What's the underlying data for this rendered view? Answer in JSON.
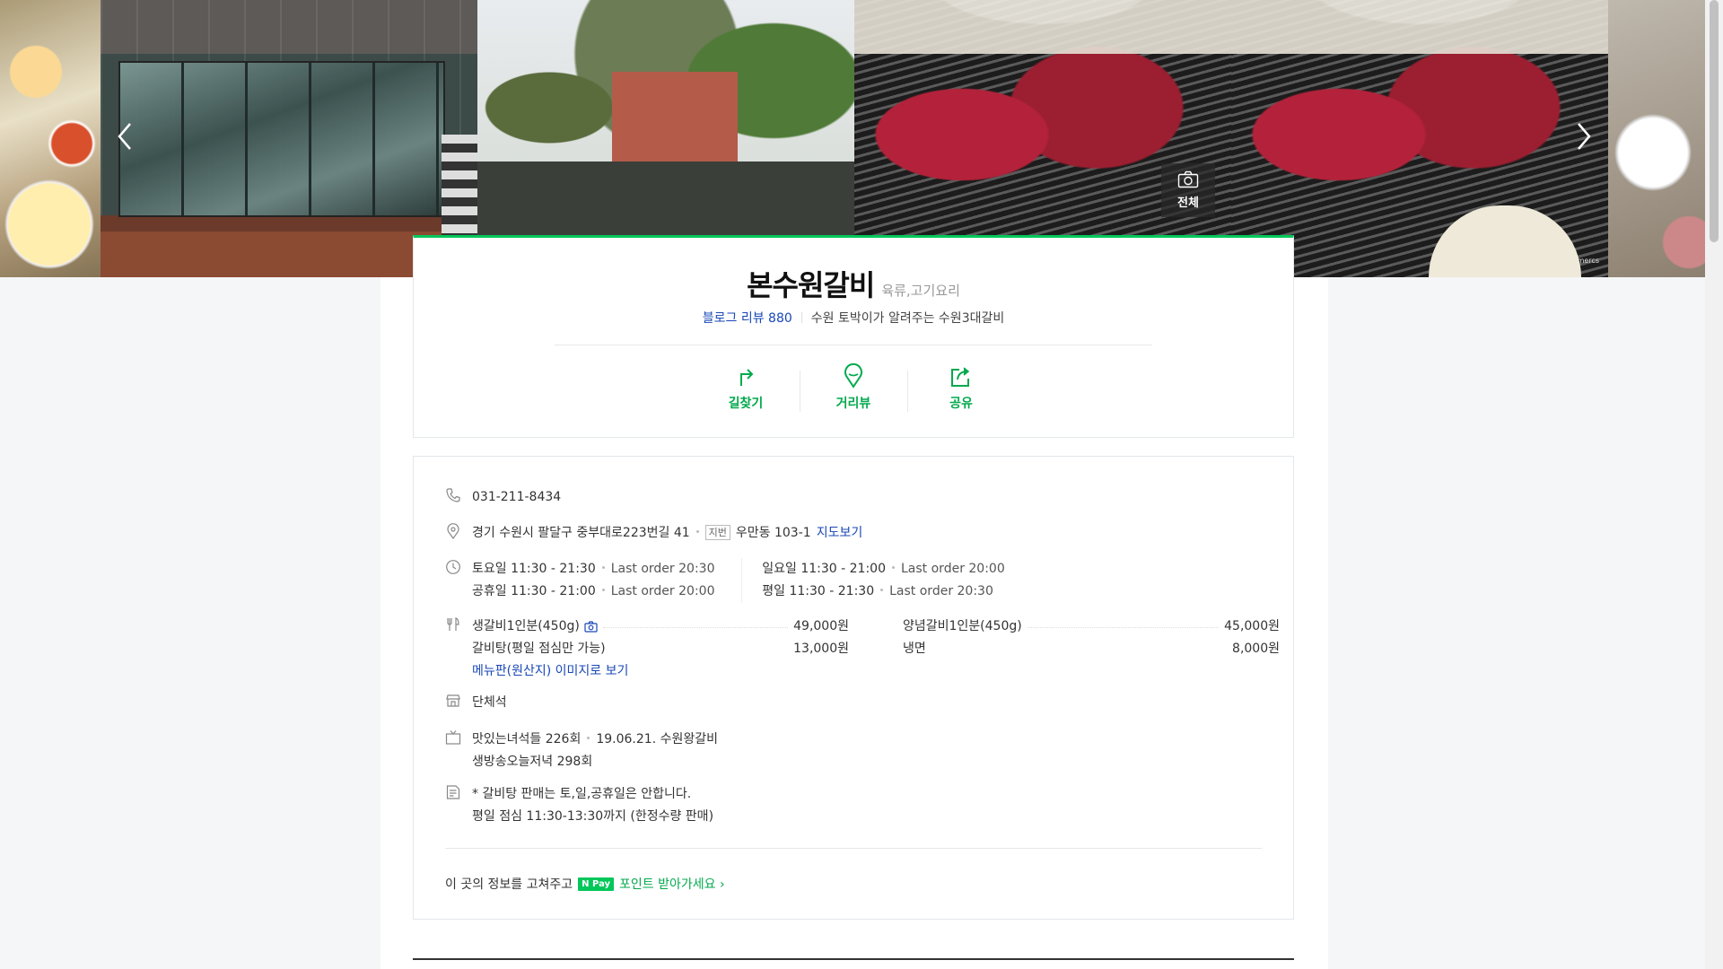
{
  "gallery": {
    "credit": "http://blog.naver.com/mercs",
    "all_photos_label": "전체"
  },
  "place": {
    "name": "본수원갈비",
    "category": "육류,고기요리",
    "blog_review": "블로그 리뷰 880",
    "slogan": "수원 토박이가 알려주는 수원3대갈비"
  },
  "actions": [
    {
      "label": "길찾기",
      "icon": "directions-icon"
    },
    {
      "label": "거리뷰",
      "icon": "street-view-icon"
    },
    {
      "label": "공유",
      "icon": "share-icon"
    }
  ],
  "info": {
    "phone": "031-211-8434",
    "address": "경기 수원시 팔달구 중부대로223번길 41",
    "jibeon_tag": "지번",
    "jibeon": "우만동 103-1",
    "map_link": "지도보기",
    "hours": [
      {
        "day": "토요일 11:30 - 21:30",
        "last": "Last order 20:30"
      },
      {
        "day": "일요일 11:30 - 21:00",
        "last": "Last order 20:00"
      },
      {
        "day": "공휴일 11:30 - 21:00",
        "last": "Last order 20:00"
      },
      {
        "day": "평일 11:30 - 21:30",
        "last": "Last order 20:30"
      }
    ],
    "menu": [
      {
        "name": "생갈비1인분(450g)",
        "price": "49,000원"
      },
      {
        "name": "양념갈비1인분(450g)",
        "price": "45,000원"
      },
      {
        "name": "갈비탕(평일 점심만 가능)",
        "price": "13,000원"
      },
      {
        "name": "냉면",
        "price": "8,000원"
      }
    ],
    "menu_link": "메뉴판(원산지) 이미지로 보기",
    "facility": "단체석",
    "tv": {
      "line1_a": "맛있는녀석들 226회",
      "line1_b": "19.06.21. 수원왕갈비",
      "line2": "생방송오늘저녁 298회"
    },
    "notes": {
      "line1": "* 갈비탕 판매는 토,일,공휴일은 안합니다.",
      "line2": "평일 점심 11:30-13:30까지 (한정수량 판매)"
    },
    "fix": {
      "text": "이 곳의 정보를 고쳐주고",
      "npay": "N Pay",
      "point": "포인트 받아가세요"
    }
  },
  "colors": {
    "accent": "#03c75a",
    "link": "#1947b6"
  }
}
